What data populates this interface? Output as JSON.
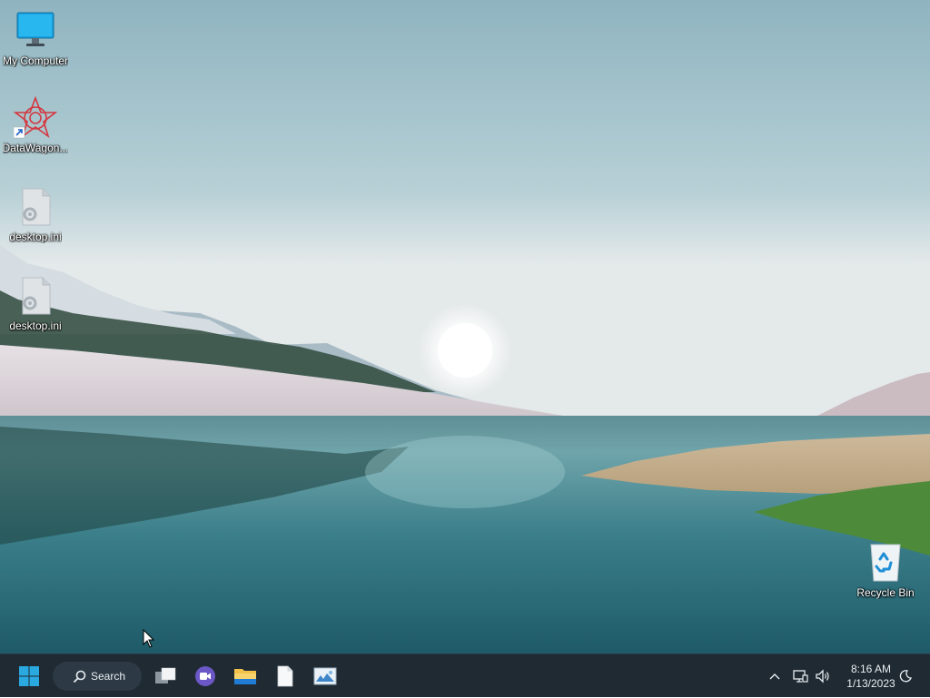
{
  "desktop": {
    "icons": [
      {
        "label": "My Computer",
        "icon": "monitor-icon"
      },
      {
        "label": "DataWagon...",
        "icon": "datawagon-shortcut-icon"
      },
      {
        "label": "desktop.ini",
        "icon": "settings-file-icon"
      },
      {
        "label": "desktop.ini",
        "icon": "settings-file-icon"
      },
      {
        "label": "Recycle Bin",
        "icon": "recycle-bin-icon"
      }
    ]
  },
  "taskbar": {
    "search_label": "Search",
    "pinned": [
      {
        "icon": "start-windows-icon"
      },
      {
        "icon": "task-view-icon"
      },
      {
        "icon": "meet-video-icon"
      },
      {
        "icon": "file-explorer-icon"
      },
      {
        "icon": "document-file-icon"
      },
      {
        "icon": "image-viewer-icon"
      }
    ]
  },
  "tray": {
    "icons": [
      "chevron-up-icon",
      "network-icon",
      "volume-icon",
      "notification-icon"
    ],
    "time": "8:16 AM",
    "date": "1/13/2023"
  },
  "colors": {
    "taskbar_bg": "#1f2a33",
    "accent": "#2aa8e0"
  }
}
